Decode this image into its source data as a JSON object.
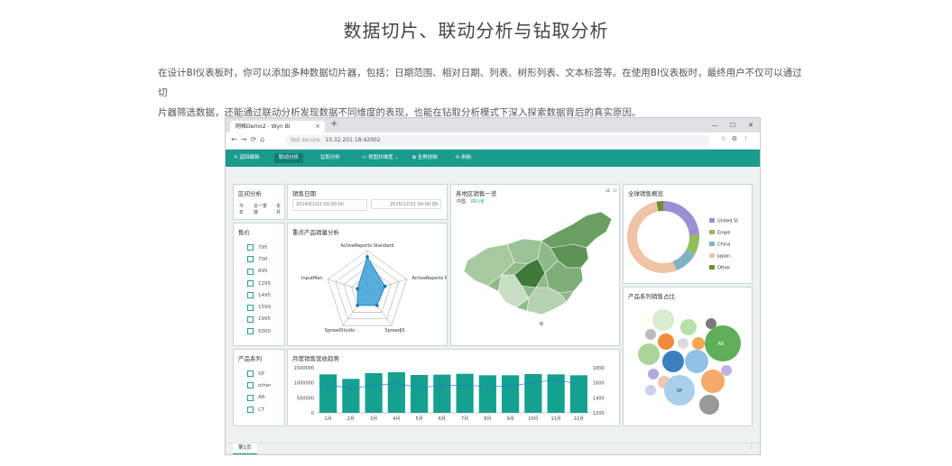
{
  "page": {
    "title": "数据切片、联动分析与钻取分析",
    "intro_line1": "在设计BI仪表板时，你可以添加多种数据切片器，包括：日期范围、相对日期、列表、树形列表、文本标签等。在使用BI仪表板时，最终用户不仅可以通过切",
    "intro_line2": "片器筛选数据，还能通过联动分析发现数据不同维度的表现，也能在钻取分析模式下深入探索数据背后的真实原因。"
  },
  "browser": {
    "tab_title": "网格Demo2 - Wyn BI",
    "url_prefix": "Not secure",
    "url": "10.32.201.18:42002"
  },
  "toolbar": {
    "edit": "返回编辑",
    "linkage": "联动分析",
    "drill": "钻取分析",
    "view": "视图并维度",
    "fullscreen": "全屏放映",
    "refresh": "刷新"
  },
  "interval": {
    "title": "区间分析",
    "options": [
      "今年",
      "近一季度",
      "本月"
    ]
  },
  "date": {
    "title": "销售日期",
    "start": "2014/01/01 00:00:00",
    "end": "2016/12/31 00:00:00"
  },
  "price": {
    "title": "售价",
    "items": [
      "795",
      "700",
      "895",
      "1295",
      "1495",
      "1599",
      "1995",
      "5000"
    ]
  },
  "series": {
    "title": "产品系列",
    "items": [
      "SP",
      "other",
      "AR",
      "CT"
    ]
  },
  "radar": {
    "title": "重点产品销量分析"
  },
  "map": {
    "title": "各地区销售一览",
    "tabs": [
      "中国",
      "四川省"
    ]
  },
  "donut": {
    "title": "全球销售概览"
  },
  "bubble": {
    "title": "产品系列销售占比"
  },
  "trend": {
    "title": "月度销售营收趋势"
  },
  "sheet_tab": "第1页",
  "chart_data": [
    {
      "type": "radar",
      "title": "重点产品销量分析",
      "categories": [
        "ActiveReports Standard",
        "ActiveReports P",
        "SpreadJS",
        "SpreadStudio",
        "InputMan"
      ],
      "values": [
        0.85,
        0.45,
        0.4,
        0.4,
        0.25
      ]
    },
    {
      "type": "pie",
      "title": "全球销售概览",
      "categories": [
        "United St",
        "Erope",
        "China",
        "Japan",
        "Other"
      ],
      "values": [
        24,
        9,
        11,
        53,
        3
      ],
      "colors": [
        "#9b8fd6",
        "#8fbf5a",
        "#7fb3c2",
        "#efc3a6",
        "#7a8a2a"
      ]
    },
    {
      "type": "bar",
      "title": "月度销售营收趋势",
      "categories": [
        "1月",
        "2月",
        "3月",
        "4月",
        "5月",
        "6月",
        "7月",
        "8月",
        "9月",
        "10月",
        "11月",
        "12月"
      ],
      "series": [
        {
          "values": [
            1280000,
            1130000,
            1320000,
            1350000,
            1260000,
            1270000,
            1300000,
            1250000,
            1250000,
            1290000,
            1280000,
            1250000
          ]
        },
        {
          "values": [
            1580,
            1520,
            1570,
            1590,
            1540,
            1560,
            1570,
            1550,
            1560,
            1600,
            1640,
            1580
          ]
        }
      ],
      "ylim": [
        0,
        1500000
      ],
      "y2lim": [
        1200,
        1800
      ],
      "yticks": [
        "1500000",
        "1000000",
        "500000",
        "0"
      ],
      "y2ticks": [
        "1800",
        "1600",
        "1400",
        "1200"
      ]
    }
  ]
}
